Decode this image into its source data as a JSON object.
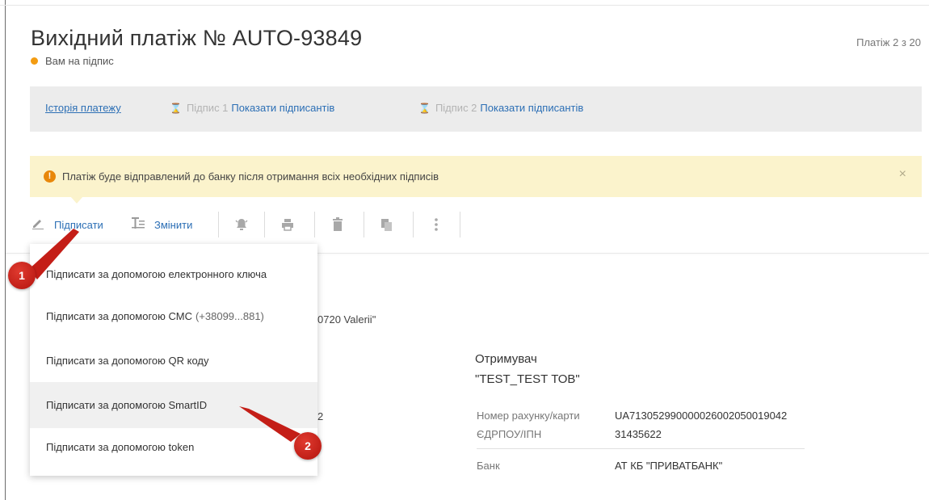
{
  "header": {
    "title": "Вихідний платіж № AUTO-93849",
    "counter": "Платіж 2 з 20",
    "status": "Вам на підпис",
    "status_color": "#f39c12"
  },
  "history_bar": {
    "history_link": "Історія платежу",
    "signature1_label": "Підпис 1",
    "signature1_link": "Показати підписантів",
    "signature2_label": "Підпис 2",
    "signature2_link": "Показати підписантів"
  },
  "warning": {
    "message": "Платіж буде відправлений до банку після отримання всіх необхідних підписів",
    "close": "×",
    "info_icon": "!"
  },
  "toolbar": {
    "sign_label": "Підписати",
    "edit_label": "Змінити",
    "icons": [
      "pencil-icon",
      "edit-text-icon",
      "bell-icon",
      "print-icon",
      "trash-icon",
      "copy-icon",
      "more-icon"
    ]
  },
  "dropdown": {
    "items": [
      {
        "label": "Підписати за допомогою електронного ключа"
      },
      {
        "label": "Підписати за допомогою СМС",
        "extra": "(+38099...881)"
      },
      {
        "label": "Підписати за допомогою QR коду"
      },
      {
        "label": "Підписати за допомогою SmartID"
      },
      {
        "label": "Підписати за допомогою token"
      }
    ]
  },
  "background": {
    "partial_payer": "0720 Valerii\"",
    "partial_account": "2"
  },
  "recipient": {
    "label": "Отримувач",
    "name": "\"TEST_TEST ТОВ\"",
    "account_label": "Номер рахунку/карти",
    "account_value": "UA713052990000026002050019042",
    "code_label": "ЄДРПОУ/ІПН",
    "code_value": "31435622",
    "bank_label": "Банк",
    "bank_value": "АТ КБ \"ПРИВАТБАНК\""
  },
  "annotations": {
    "badge1": "1",
    "badge2": "2",
    "badge_color": "#c8201a"
  }
}
